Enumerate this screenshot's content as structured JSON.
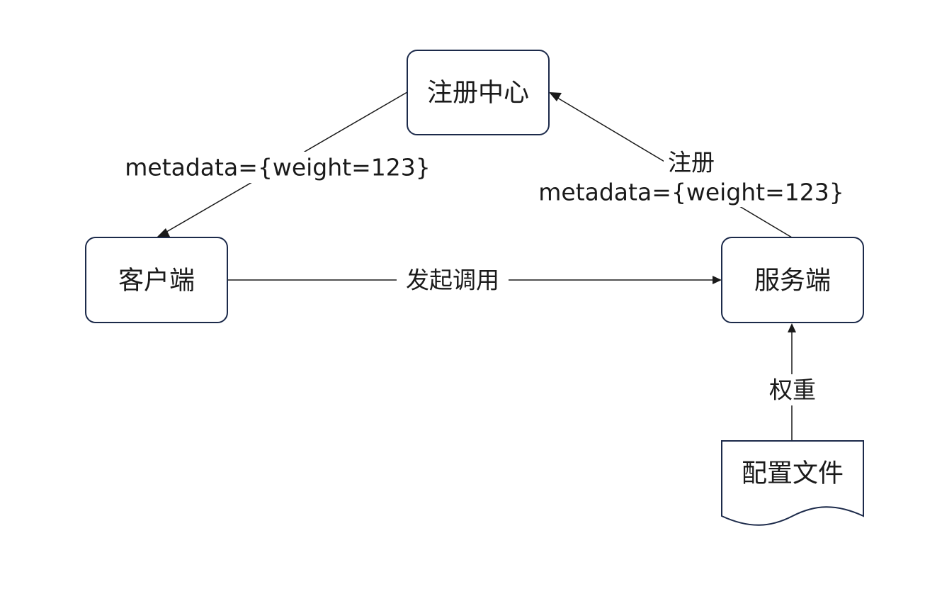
{
  "nodes": {
    "registry": "注册中心",
    "client": "客户端",
    "server": "服务端",
    "config_file": "配置文件"
  },
  "edges": {
    "registry_to_client": "metadata={weight=123}",
    "server_to_registry_line1": "注册",
    "server_to_registry_line2": "metadata={weight=123}",
    "client_to_server": "发起调用",
    "config_to_server": "权重"
  }
}
